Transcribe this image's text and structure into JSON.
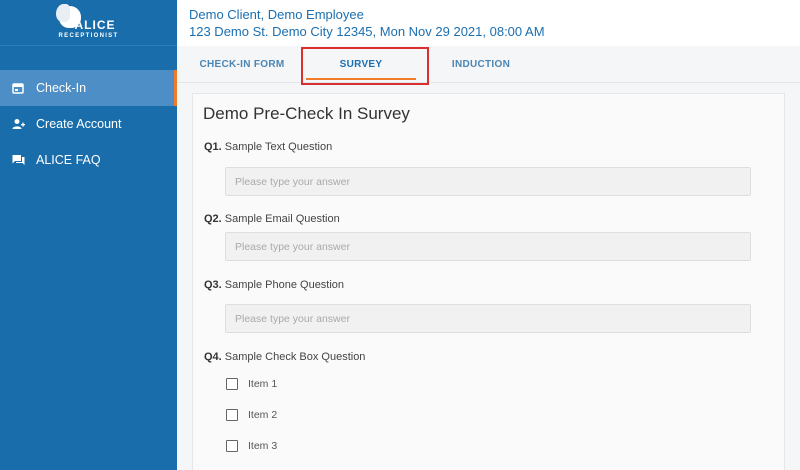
{
  "sidebar": {
    "logo": {
      "word1": "ALICE",
      "word2": "RECEPTIONIST"
    },
    "items": [
      {
        "label": "Check-In",
        "icon": "calendar-icon",
        "active": true
      },
      {
        "label": "Create Account",
        "icon": "add-user-icon",
        "active": false
      },
      {
        "label": "ALICE FAQ",
        "icon": "chat-icon",
        "active": false
      }
    ]
  },
  "header": {
    "line1": "Demo Client, Demo Employee",
    "line2": "123 Demo St. Demo City 12345, Mon Nov 29 2021, 08:00 AM"
  },
  "tabs": [
    {
      "label": "CHECK-IN FORM"
    },
    {
      "label": "SURVEY",
      "active": true
    },
    {
      "label": "INDUCTION"
    }
  ],
  "survey": {
    "title": "Demo Pre-Check In Survey",
    "questions": [
      {
        "number": "Q1.",
        "text": "Sample Text Question",
        "placeholder": "Please type your answer"
      },
      {
        "number": "Q2.",
        "text": "Sample Email Question",
        "placeholder": "Please type your answer"
      },
      {
        "number": "Q3.",
        "text": "Sample Phone Question",
        "placeholder": "Please type your answer"
      },
      {
        "number": "Q4.",
        "text": "Sample Check Box Question",
        "options": [
          "Item 1",
          "Item 2",
          "Item 3"
        ]
      }
    ]
  },
  "colors": {
    "sidebar": "#1a6dab",
    "sidebar_active": "#4c8ec5",
    "accent": "#f07c2a",
    "header_text": "#1b6fb0",
    "highlight": "#d9302f"
  }
}
